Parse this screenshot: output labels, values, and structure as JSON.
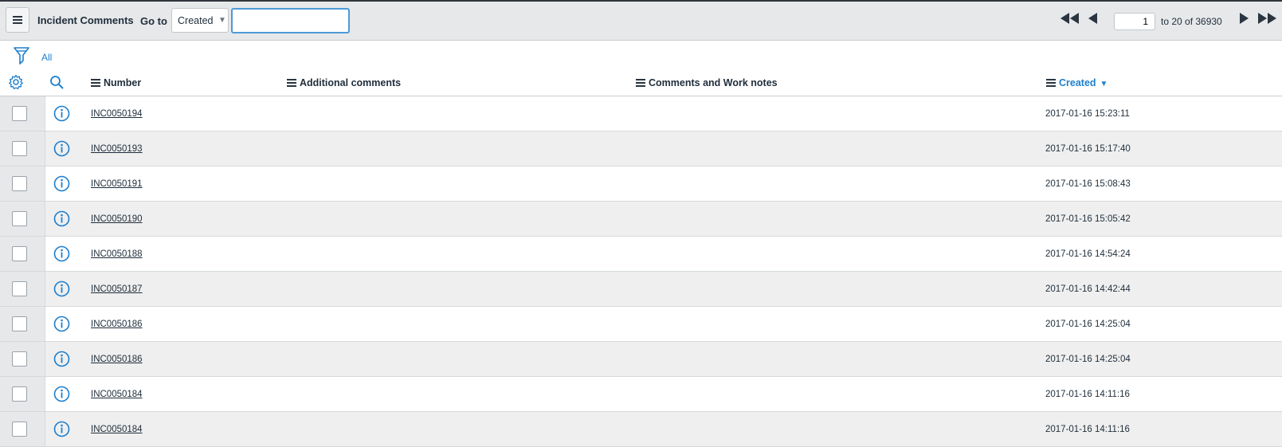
{
  "header": {
    "title": "Incident Comments",
    "goto_label": "Go to",
    "goto_field": "Created",
    "search_value": "",
    "pager": {
      "current_page": "1",
      "range_text": "to 20 of 36930"
    }
  },
  "filter": {
    "all_label": "All"
  },
  "columns": {
    "number": "Number",
    "additional_comments": "Additional comments",
    "comments_work_notes": "Comments and Work notes",
    "created": "Created"
  },
  "rows": [
    {
      "number": "INC0050194",
      "additional_comments": "",
      "comments_work_notes": "",
      "created": "2017-01-16 15:23:11"
    },
    {
      "number": "INC0050193",
      "additional_comments": "",
      "comments_work_notes": "",
      "created": "2017-01-16 15:17:40"
    },
    {
      "number": "INC0050191",
      "additional_comments": "",
      "comments_work_notes": "",
      "created": "2017-01-16 15:08:43"
    },
    {
      "number": "INC0050190",
      "additional_comments": "",
      "comments_work_notes": "",
      "created": "2017-01-16 15:05:42"
    },
    {
      "number": "INC0050188",
      "additional_comments": "",
      "comments_work_notes": "",
      "created": "2017-01-16 14:54:24"
    },
    {
      "number": "INC0050187",
      "additional_comments": "",
      "comments_work_notes": "",
      "created": "2017-01-16 14:42:44"
    },
    {
      "number": "INC0050186",
      "additional_comments": "",
      "comments_work_notes": "",
      "created": "2017-01-16 14:25:04"
    },
    {
      "number": "INC0050186",
      "additional_comments": "",
      "comments_work_notes": "",
      "created": "2017-01-16 14:25:04"
    },
    {
      "number": "INC0050184",
      "additional_comments": "",
      "comments_work_notes": "",
      "created": "2017-01-16 14:11:16"
    },
    {
      "number": "INC0050184",
      "additional_comments": "",
      "comments_work_notes": "",
      "created": "2017-01-16 14:11:16"
    }
  ],
  "colors": {
    "accent": "#1d7fce",
    "header_bg": "#e6e8ea",
    "row_alt_bg": "#efefef"
  },
  "icons": {
    "menu": "hamburger-icon",
    "filter": "funnel-icon",
    "settings": "gear-icon",
    "search": "search-icon",
    "info": "info-icon",
    "first": "double-left-icon",
    "prev": "left-icon",
    "next": "right-icon",
    "last": "double-right-icon"
  }
}
